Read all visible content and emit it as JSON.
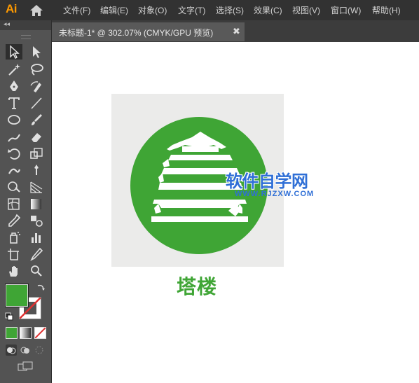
{
  "app": {
    "logo": "Ai"
  },
  "menu": {
    "items": [
      "文件(F)",
      "编辑(E)",
      "对象(O)",
      "文字(T)",
      "选择(S)",
      "效果(C)",
      "视图(V)",
      "窗口(W)",
      "帮助(H)"
    ]
  },
  "document_tab": {
    "title": "未标题-1* @ 302.07% (CMYK/GPU 预览)",
    "close": "✖"
  },
  "tools_panel": {
    "collapse": "◂◂"
  },
  "colors": {
    "fill": "#3fa535",
    "accent": "#ff9a00",
    "watermark": "#2f6fd6"
  },
  "canvas": {
    "caption": "塔楼",
    "watermark": "软件自学网",
    "watermark_url": "WWW.RJZXW.COM"
  }
}
